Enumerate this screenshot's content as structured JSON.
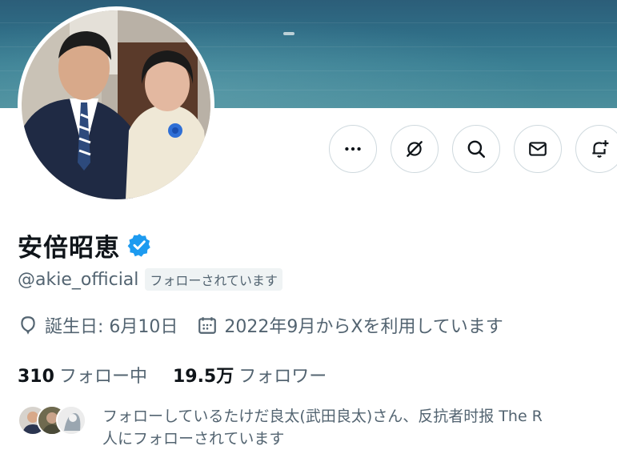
{
  "profile": {
    "name": "安倍昭恵",
    "handle": "@akie_official",
    "follows_you_badge": "フォローされています",
    "verified_icon": "verified-badge-icon",
    "birthday": "誕生日: 6月10日",
    "joined": "2022年9月からXを利用しています",
    "following_count": "310",
    "following_label": "フォロー中",
    "followers_count": "19.5万",
    "followers_label": "フォロワー",
    "followers_you_know_line1": "フォローしているたけだ良太(武田良太)さん、反抗者时报 The R",
    "followers_you_know_line2": "人にフォローされています"
  },
  "actions": [
    {
      "name": "more-button",
      "icon": "more-icon"
    },
    {
      "name": "grok-button",
      "icon": "grok-icon"
    },
    {
      "name": "search-button",
      "icon": "search-icon"
    },
    {
      "name": "message-button",
      "icon": "mail-icon"
    },
    {
      "name": "notify-button",
      "icon": "bell-plus-icon"
    }
  ],
  "colors": {
    "accent_verified": "#1d9bf0",
    "text_primary": "#0f1419",
    "text_secondary": "#536471",
    "border": "#cfd9de",
    "banner_sea": "#2f6d86"
  }
}
